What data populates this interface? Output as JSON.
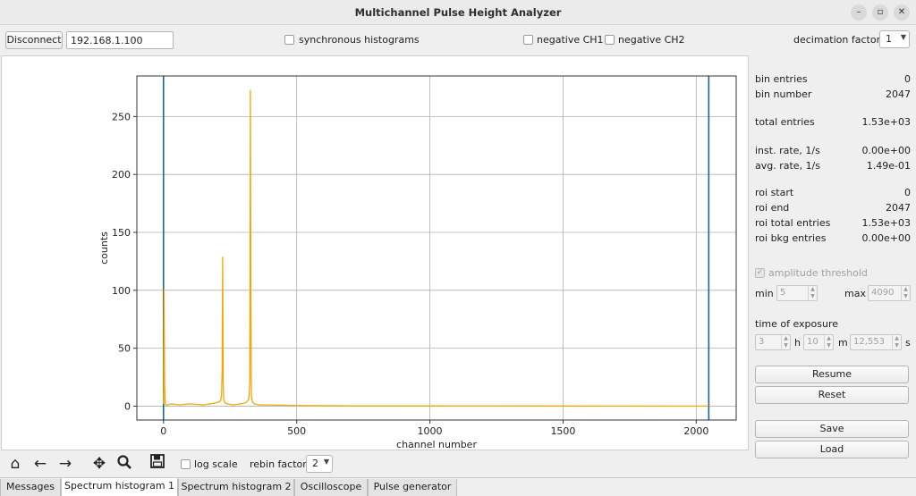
{
  "window": {
    "title": "Multichannel Pulse Height Analyzer",
    "minimize_icon": "minimize-icon",
    "restore_icon": "restore-icon",
    "close_icon": "close-icon"
  },
  "toolbar": {
    "disconnect_label": "Disconnect",
    "address_value": "192.168.1.100",
    "synchronous_label": "synchronous histograms",
    "negative_ch1_label": "negative CH1",
    "negative_ch2_label": "negative CH2",
    "decimation_label": "decimation factor",
    "decimation_value": "1"
  },
  "colors": {
    "trace": "#f5a700",
    "roi_marker": "#1f6391",
    "grid": "#b0b0b0"
  },
  "chart_data": {
    "type": "line",
    "xlabel": "channel number",
    "ylabel": "counts",
    "xlim": [
      -100,
      2150
    ],
    "ylim": [
      -12,
      285
    ],
    "xticks": [
      0,
      500,
      1000,
      1500,
      2000
    ],
    "yticks": [
      0,
      50,
      100,
      150,
      200,
      250
    ],
    "grid": true,
    "roi_markers": [
      0,
      2047
    ],
    "series": [
      {
        "x": [
          0,
          2,
          4,
          6,
          8,
          15,
          30,
          60,
          100,
          150,
          200,
          210,
          215,
          218,
          220,
          222,
          224,
          226,
          230,
          240,
          260,
          290,
          310,
          320,
          324,
          326,
          328,
          330,
          332,
          334,
          340,
          360,
          400,
          500,
          700,
          1000,
          1500,
          2047
        ],
        "y": [
          2,
          101,
          20,
          3,
          1,
          1,
          2,
          1,
          2,
          1,
          3,
          4,
          5,
          10,
          30,
          129,
          20,
          6,
          3,
          2,
          1,
          2,
          3,
          6,
          20,
          273,
          100,
          10,
          6,
          4,
          2,
          1,
          1,
          0.5,
          0.3,
          0.2,
          0.1,
          0
        ]
      }
    ]
  },
  "nav": {
    "home_icon": "home-icon",
    "back_icon": "back-arrow-icon",
    "forward_icon": "forward-arrow-icon",
    "pan_icon": "pan-icon",
    "zoom_icon": "zoom-icon",
    "save_icon": "save-icon",
    "log_scale_label": "log scale",
    "rebin_label": "rebin factor",
    "rebin_value": "2"
  },
  "stats": {
    "bin_entries_label": "bin entries",
    "bin_entries_value": "0",
    "bin_number_label": "bin number",
    "bin_number_value": "2047",
    "total_entries_label": "total entries",
    "total_entries_value": "1.53e+03",
    "inst_rate_label": "inst. rate, 1/s",
    "inst_rate_value": "0.00e+00",
    "avg_rate_label": "avg. rate, 1/s",
    "avg_rate_value": "1.49e-01",
    "roi_start_label": "roi start",
    "roi_start_value": "0",
    "roi_end_label": "roi end",
    "roi_end_value": "2047",
    "roi_total_label": "roi total entries",
    "roi_total_value": "1.53e+03",
    "roi_bkg_label": "roi bkg entries",
    "roi_bkg_value": "0.00e+00"
  },
  "threshold": {
    "label": "amplitude threshold",
    "min_label": "min",
    "min_value": "5",
    "max_label": "max",
    "max_value": "4090"
  },
  "exposure": {
    "label": "time of exposure",
    "hours_value": "3",
    "hours_unit": "h",
    "minutes_value": "10",
    "minutes_unit": "m",
    "seconds_value": "12,553",
    "seconds_unit": "s"
  },
  "actions": {
    "resume_label": "Resume",
    "reset_label": "Reset",
    "save_label": "Save",
    "load_label": "Load"
  },
  "tabs": [
    "Messages",
    "Spectrum histogram 1",
    "Spectrum histogram 2",
    "Oscilloscope",
    "Pulse generator"
  ]
}
